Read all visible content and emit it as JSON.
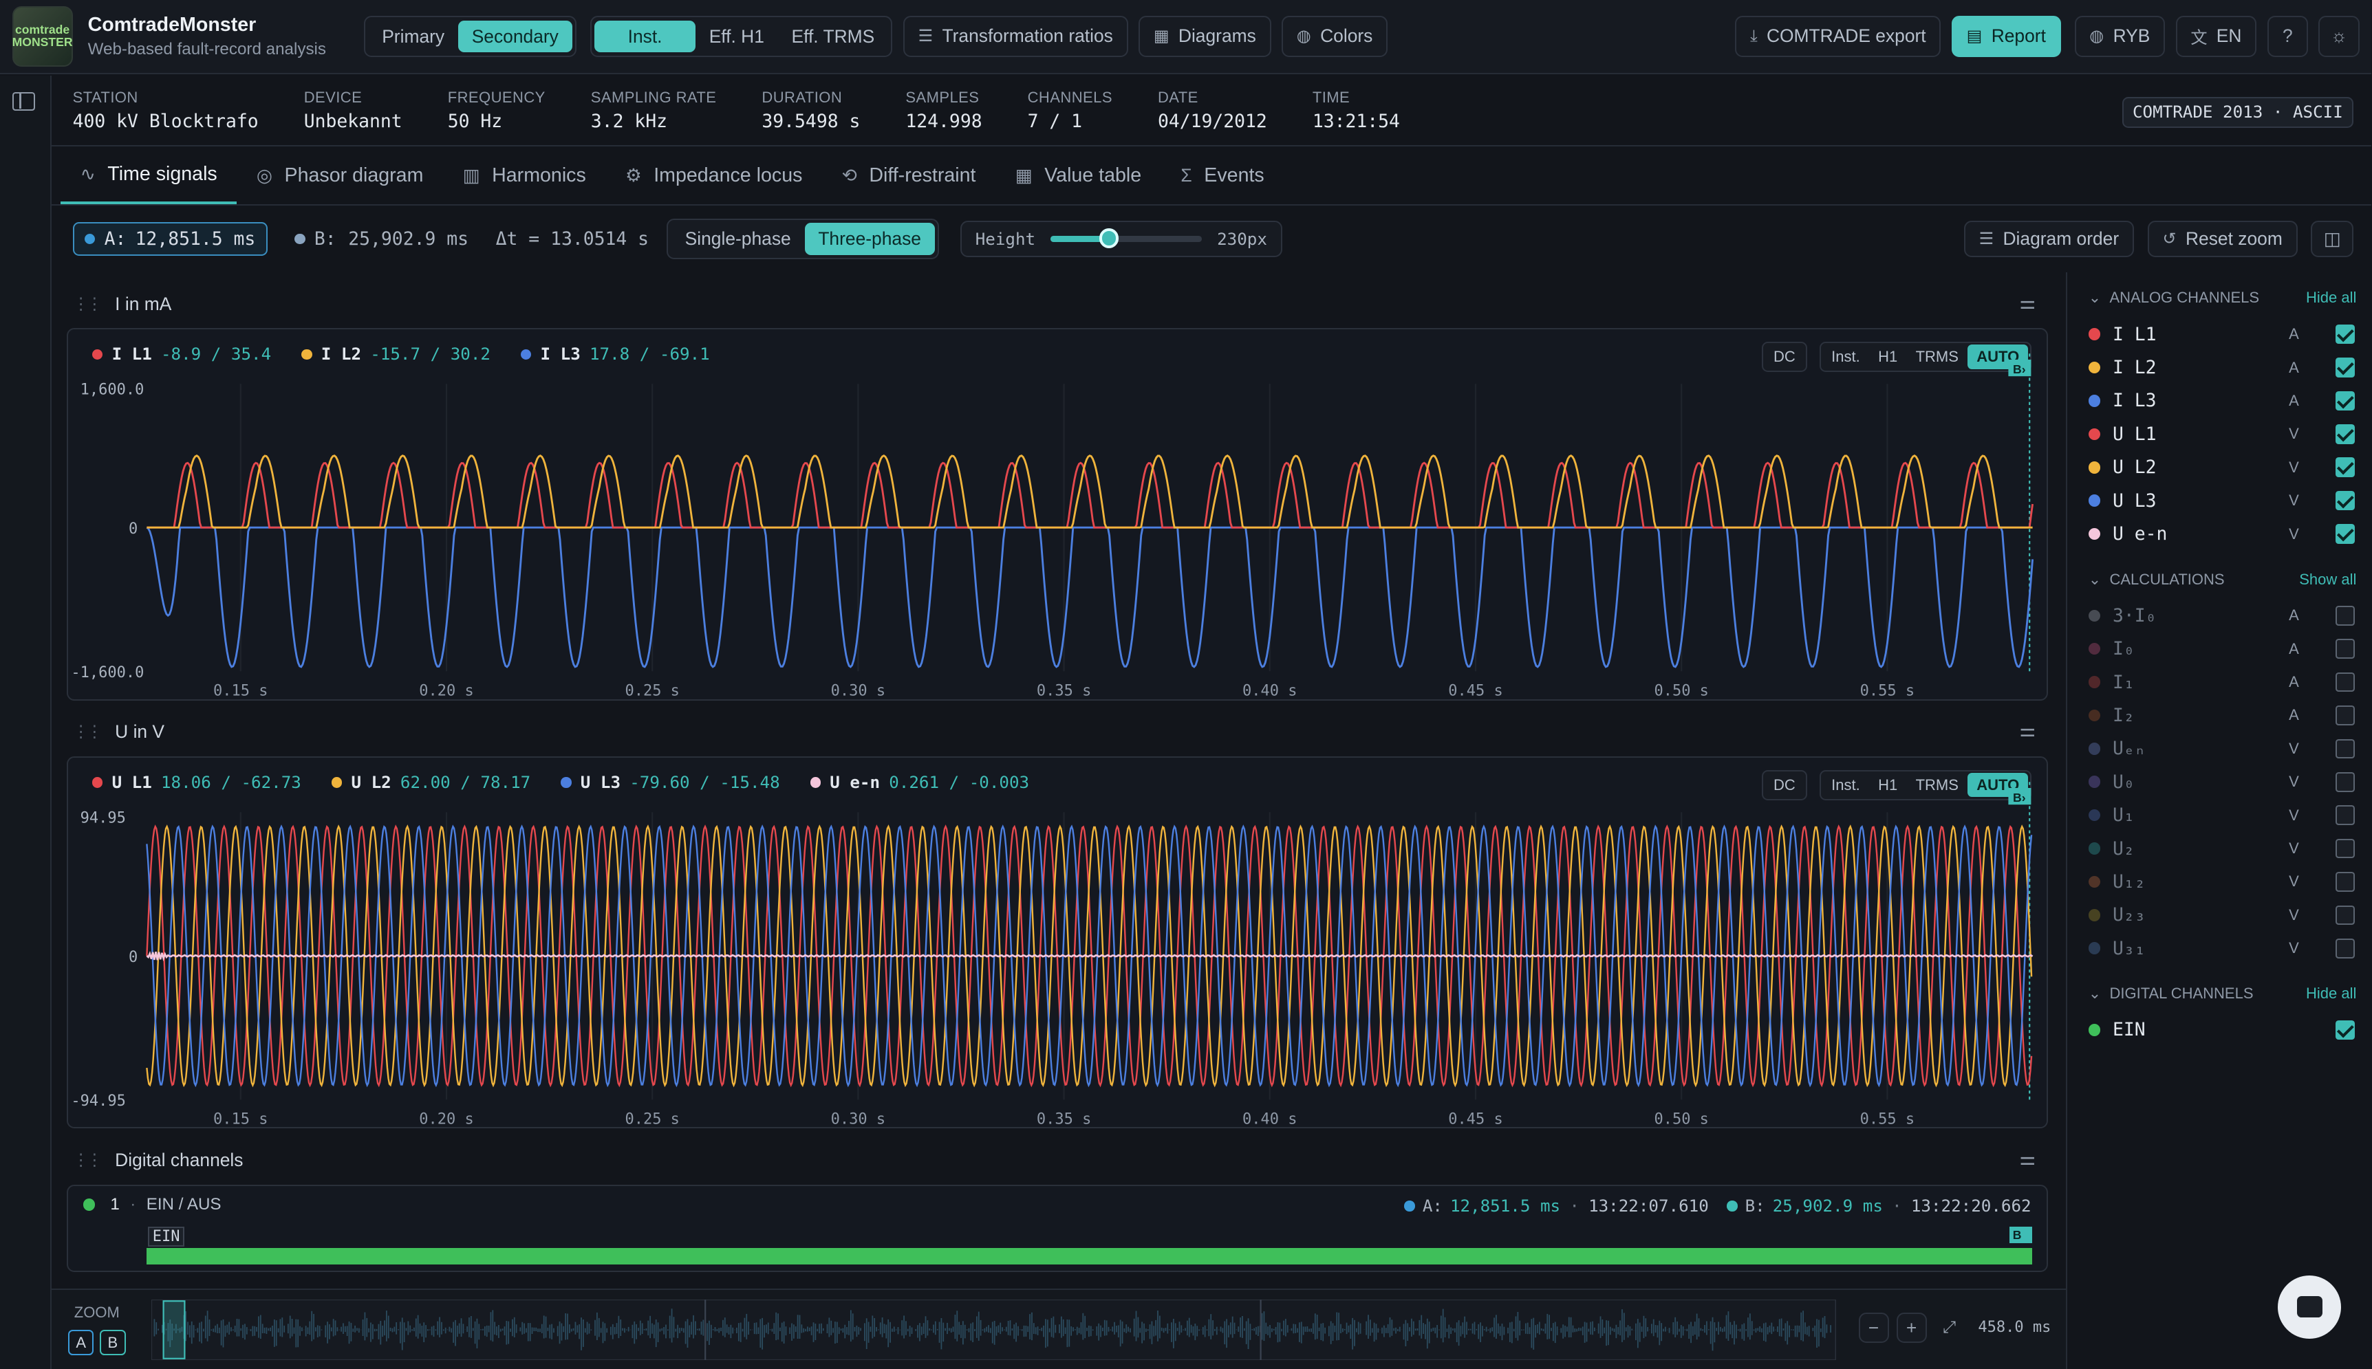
{
  "app": {
    "title": "ComtradeMonster",
    "subtitle": "Web-based fault-record analysis",
    "logo_text": "comtrade MONSTER"
  },
  "header": {
    "value_mode": [
      "Primary",
      "Secondary"
    ],
    "value_mode_selected": "Secondary",
    "calc_mode": [
      "Inst.",
      "Eff. H1",
      "Eff. TRMS"
    ],
    "calc_mode_selected": "Inst.",
    "transformation_ratios": "Transformation ratios",
    "diagrams": "Diagrams",
    "colors": "Colors",
    "comtrade_export": "COMTRADE export",
    "report": "Report",
    "phase_naming": "RYB",
    "language": "EN"
  },
  "record": {
    "station": {
      "label": "STATION",
      "value": "400 kV Blocktrafo"
    },
    "device": {
      "label": "DEVICE",
      "value": "Unbekannt"
    },
    "frequency": {
      "label": "FREQUENCY",
      "value": "50 Hz"
    },
    "sampling": {
      "label": "SAMPLING RATE",
      "value": "3.2 kHz"
    },
    "duration": {
      "label": "DURATION",
      "value": "39.5498 s"
    },
    "samples": {
      "label": "SAMPLES",
      "value": "124.998"
    },
    "channels": {
      "label": "CHANNELS",
      "value": "7 / 1"
    },
    "date": {
      "label": "DATE",
      "value": "04/19/2012"
    },
    "time": {
      "label": "TIME",
      "value": "13:21:54"
    },
    "format": "COMTRADE 2013 · ASCII"
  },
  "tabs": [
    "Time signals",
    "Phasor diagram",
    "Harmonics",
    "Impedance locus",
    "Diff-restraint",
    "Value table",
    "Events"
  ],
  "tab_selected": "Time signals",
  "toolbar": {
    "cursor_a_label": "A:",
    "cursor_a": "12,851.5 ms",
    "cursor_b_label": "B:",
    "cursor_b": "25,902.9 ms",
    "delta": "Δt = 13.0514 s",
    "phase_mode": [
      "Single-phase",
      "Three-phase"
    ],
    "phase_selected": "Three-phase",
    "height_label": "Height",
    "height_value": "230px",
    "height_fraction": 0.38,
    "diagram_order": "Diagram order",
    "reset_zoom": "Reset zoom"
  },
  "panels": {
    "current": {
      "title": "I  in mA",
      "ytop": "1,600.0",
      "ymid": "0",
      "ybot": "-1,600.0",
      "legend": [
        {
          "name": "I L1",
          "value": "-8.9 / 35.4",
          "color": "#e5484d"
        },
        {
          "name": "I L2",
          "value": "-15.7 / 30.2",
          "color": "#f0b43c"
        },
        {
          "name": "I L3",
          "value": "17.8 / -69.1",
          "color": "#4c7fe0"
        }
      ]
    },
    "voltage": {
      "title": "U  in V",
      "ytop": "94.95",
      "ymid": "0",
      "ybot": "-94.95",
      "legend": [
        {
          "name": "U L1",
          "value": "18.06 / -62.73",
          "color": "#e5484d"
        },
        {
          "name": "U L2",
          "value": "62.00 / 78.17",
          "color": "#f0b43c"
        },
        {
          "name": "U L3",
          "value": "-79.60 / -15.48",
          "color": "#4c7fe0"
        },
        {
          "name": "U e-n",
          "value": "0.261 / -0.003",
          "color": "#f5c6dc"
        }
      ]
    },
    "digital": {
      "title": "Digital channels",
      "index": "1",
      "channel": "EIN / AUS",
      "trace_label": "EIN",
      "cursor_a_label": "A:",
      "cursor_a": "12,851.5 ms",
      "time_a": "13:22:07.610",
      "cursor_b_label": "B:",
      "cursor_b": "25,902.9 ms",
      "time_b": "13:22:20.662"
    },
    "modes": [
      "DC",
      "Inst.",
      "H1",
      "TRMS",
      "AUTO"
    ],
    "mode_selected": "AUTO",
    "b_marker": "B",
    "x_ticks": [
      "0.15 s",
      "0.20 s",
      "0.25 s",
      "0.30 s",
      "0.35 s",
      "0.40 s",
      "0.45 s",
      "0.50 s",
      "0.55 s"
    ]
  },
  "chart_data": [
    {
      "type": "line",
      "ylabel": "I in mA",
      "ylim": [
        -1600,
        1600
      ],
      "x": [
        "0.15 s",
        "0.20 s",
        "0.25 s",
        "0.30 s",
        "0.35 s",
        "0.40 s",
        "0.45 s",
        "0.50 s",
        "0.55 s"
      ],
      "series": [
        {
          "name": "I L1"
        },
        {
          "name": "I L2"
        },
        {
          "name": "I L3"
        }
      ]
    },
    {
      "type": "line",
      "ylabel": "U in V",
      "ylim": [
        -94.95,
        94.95
      ],
      "x": [
        "0.15 s",
        "0.20 s",
        "0.25 s",
        "0.30 s",
        "0.35 s",
        "0.40 s",
        "0.45 s",
        "0.50 s",
        "0.55 s"
      ],
      "series": [
        {
          "name": "U L1"
        },
        {
          "name": "U L2"
        },
        {
          "name": "U L3"
        },
        {
          "name": "U e-n"
        }
      ]
    }
  ],
  "sidebar": {
    "analog": {
      "title": "ANALOG CHANNELS",
      "action": "Hide all",
      "items": [
        {
          "name": "I L1",
          "unit": "A",
          "color": "#e5484d",
          "checked": true
        },
        {
          "name": "I L2",
          "unit": "A",
          "color": "#f0b43c",
          "checked": true
        },
        {
          "name": "I L3",
          "unit": "A",
          "color": "#4c7fe0",
          "checked": true
        },
        {
          "name": "U L1",
          "unit": "V",
          "color": "#e5484d",
          "checked": true
        },
        {
          "name": "U L2",
          "unit": "V",
          "color": "#f0b43c",
          "checked": true
        },
        {
          "name": "U L3",
          "unit": "V",
          "color": "#4c7fe0",
          "checked": true
        },
        {
          "name": "U e-n",
          "unit": "V",
          "color": "#f5c6dc",
          "checked": true
        }
      ]
    },
    "calc": {
      "title": "CALCULATIONS",
      "action": "Show all",
      "items": [
        {
          "name": "3·I₀",
          "unit": "A",
          "color": "#8a8f99"
        },
        {
          "name": "I₀",
          "unit": "A",
          "color": "#a0466b"
        },
        {
          "name": "I₁",
          "unit": "A",
          "color": "#a03f3f"
        },
        {
          "name": "I₂",
          "unit": "A",
          "color": "#8a4a2a"
        },
        {
          "name": "Uₑₙ",
          "unit": "V",
          "color": "#5d6fa8"
        },
        {
          "name": "U₀",
          "unit": "V",
          "color": "#6a5aa8"
        },
        {
          "name": "U₁",
          "unit": "V",
          "color": "#4a62a0"
        },
        {
          "name": "U₂",
          "unit": "V",
          "color": "#2f8a8a"
        },
        {
          "name": "U₁₂",
          "unit": "V",
          "color": "#a05a3a"
        },
        {
          "name": "U₂₃",
          "unit": "V",
          "color": "#8a7a2a"
        },
        {
          "name": "U₃₁",
          "unit": "V",
          "color": "#4a6a9a"
        }
      ]
    },
    "digital": {
      "title": "DIGITAL CHANNELS",
      "action": "Hide all",
      "items": [
        {
          "name": "EIN",
          "color": "#3fbf5a",
          "checked": true
        }
      ]
    }
  },
  "zoom": {
    "label": "ZOOM",
    "a": "A",
    "b": "B",
    "window": "458.0 ms"
  }
}
